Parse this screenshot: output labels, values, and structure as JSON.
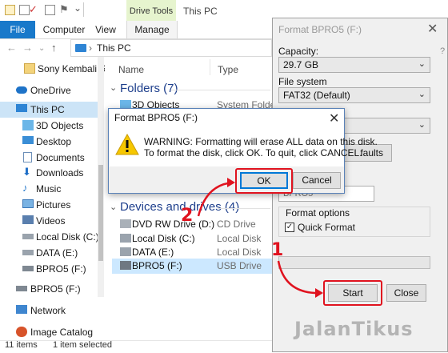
{
  "window": {
    "title": "This PC",
    "context_tab": "Drive Tools"
  },
  "ribbon": {
    "tabs": [
      "File",
      "Computer",
      "View",
      "Manage"
    ]
  },
  "address": {
    "path": "This PC"
  },
  "sidebar": {
    "items": [
      {
        "label": "Sony Kembali Ri",
        "icon": "folder-icon"
      },
      {
        "label": "OneDrive",
        "icon": "onedrive-icon"
      },
      {
        "label": "This PC",
        "icon": "pc-icon"
      },
      {
        "label": "3D Objects",
        "icon": "3d-objects-icon"
      },
      {
        "label": "Desktop",
        "icon": "desktop-icon"
      },
      {
        "label": "Documents",
        "icon": "documents-icon"
      },
      {
        "label": "Downloads",
        "icon": "downloads-icon"
      },
      {
        "label": "Music",
        "icon": "music-icon"
      },
      {
        "label": "Pictures",
        "icon": "pictures-icon"
      },
      {
        "label": "Videos",
        "icon": "videos-icon"
      },
      {
        "label": "Local Disk (C:)",
        "icon": "disk-icon"
      },
      {
        "label": "DATA (E:)",
        "icon": "disk-icon"
      },
      {
        "label": "BPRO5 (F:)",
        "icon": "usb-icon"
      },
      {
        "label": "BPRO5 (F:)",
        "icon": "usb-icon"
      },
      {
        "label": "Network",
        "icon": "network-icon"
      },
      {
        "label": "Image Catalog",
        "icon": "image-catalog-icon"
      }
    ]
  },
  "columns": {
    "name": "Name",
    "type": "Type"
  },
  "folders": {
    "heading": "Folders (7)",
    "rows": [
      {
        "name": "3D Objects",
        "type": "System Folder"
      }
    ]
  },
  "devices": {
    "heading": "Devices and drives (4)",
    "rows": [
      {
        "name": "DVD RW Drive (D:)",
        "type": "CD Drive"
      },
      {
        "name": "Local Disk (C:)",
        "type": "Local Disk"
      },
      {
        "name": "DATA (E:)",
        "type": "Local Disk"
      },
      {
        "name": "BPRO5 (F:)",
        "type": "USB Drive"
      }
    ]
  },
  "status": {
    "count": "11 items",
    "selected": "1 item selected"
  },
  "format_window": {
    "title": "Format BPRO5 (F:)",
    "capacity_label": "Capacity:",
    "capacity_value": "29.7 GB",
    "filesystem_label": "File system",
    "filesystem_value": "FAT32 (Default)",
    "partial_button": "faults",
    "volume_partial": "BPRO5",
    "options_label": "Format options",
    "quick_format_label": "Quick Format",
    "quick_format_checked": true,
    "start_label": "Start",
    "close_label": "Close"
  },
  "warning_dialog": {
    "title": "Format BPRO5 (F:)",
    "line1": "WARNING: Formatting will erase ALL data on this disk.",
    "line2": "To format the disk, click OK. To quit, click CANCEL.",
    "ok_label": "OK",
    "cancel_label": "Cancel"
  },
  "annotations": {
    "step1": "1",
    "step2": "2",
    "highlight_color": "#e0131f"
  },
  "watermark": "JalanTikus",
  "colors": {
    "accent": "#1979ca",
    "drive_tools": "#e6f4ce",
    "warning": "#f6c700"
  }
}
